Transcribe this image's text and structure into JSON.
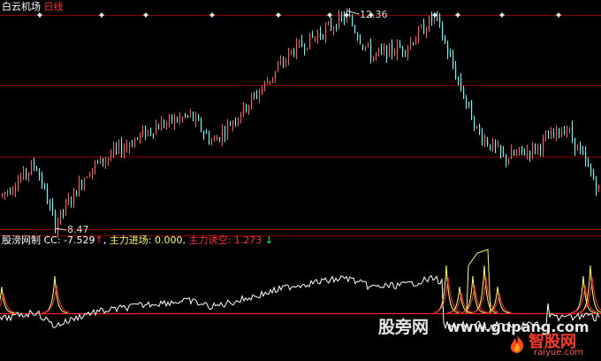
{
  "price_panel": {
    "stock_name": "白云机场",
    "period": "日线",
    "low_annotation": "8.47",
    "high_annotation": "12.36"
  },
  "indicator_panel": {
    "name": "股滂网制",
    "cc_label": "CC:",
    "cc_value": "-7.529",
    "cc_arrow": "↑",
    "inflow_label": "主力进场:",
    "inflow_value": "0.000",
    "lure_label": "主力诱空:",
    "lure_value": "1.273",
    "lure_arrow": "↓"
  },
  "watermark": {
    "site_cn": "股旁网",
    "site_url": "www.gupang.com",
    "logo_cn": "智股网",
    "logo_url": "raiyue.com"
  },
  "colors": {
    "background": "#000000",
    "up_candle": "#ff5a5a",
    "down_candle": "#54ffff",
    "grid": "#8a0000",
    "cc_line": "#ffffff",
    "spike_yellow": "#ffff66",
    "spike_red": "#ff3030",
    "inflow_text": "#ffff66",
    "lure_text": "#ff3030",
    "zero_line": "#ff2020"
  },
  "chart_data": {
    "type": "candlestick",
    "price_low": 8.47,
    "price_high": 12.36,
    "trend_keypoints": [
      [
        0,
        9.0
      ],
      [
        40,
        9.6
      ],
      [
        62,
        8.47
      ],
      [
        100,
        9.5
      ],
      [
        175,
        10.3
      ],
      [
        215,
        10.5
      ],
      [
        240,
        10.0
      ],
      [
        290,
        10.9
      ],
      [
        330,
        11.7
      ],
      [
        392,
        12.36
      ],
      [
        420,
        11.6
      ],
      [
        460,
        11.8
      ],
      [
        492,
        12.36
      ],
      [
        510,
        11.5
      ],
      [
        540,
        10.2
      ],
      [
        570,
        9.7
      ],
      [
        605,
        9.9
      ],
      [
        640,
        10.3
      ],
      [
        678,
        9.1
      ]
    ],
    "star_marker_x": [
      45,
      115,
      165,
      240,
      315,
      373,
      392,
      420,
      492,
      518,
      568,
      632
    ],
    "indicator": {
      "cc_series_note": "white oscillator line",
      "spike_x": [
        2,
        62,
        505,
        520,
        535,
        548,
        563,
        660,
        668
      ]
    }
  }
}
